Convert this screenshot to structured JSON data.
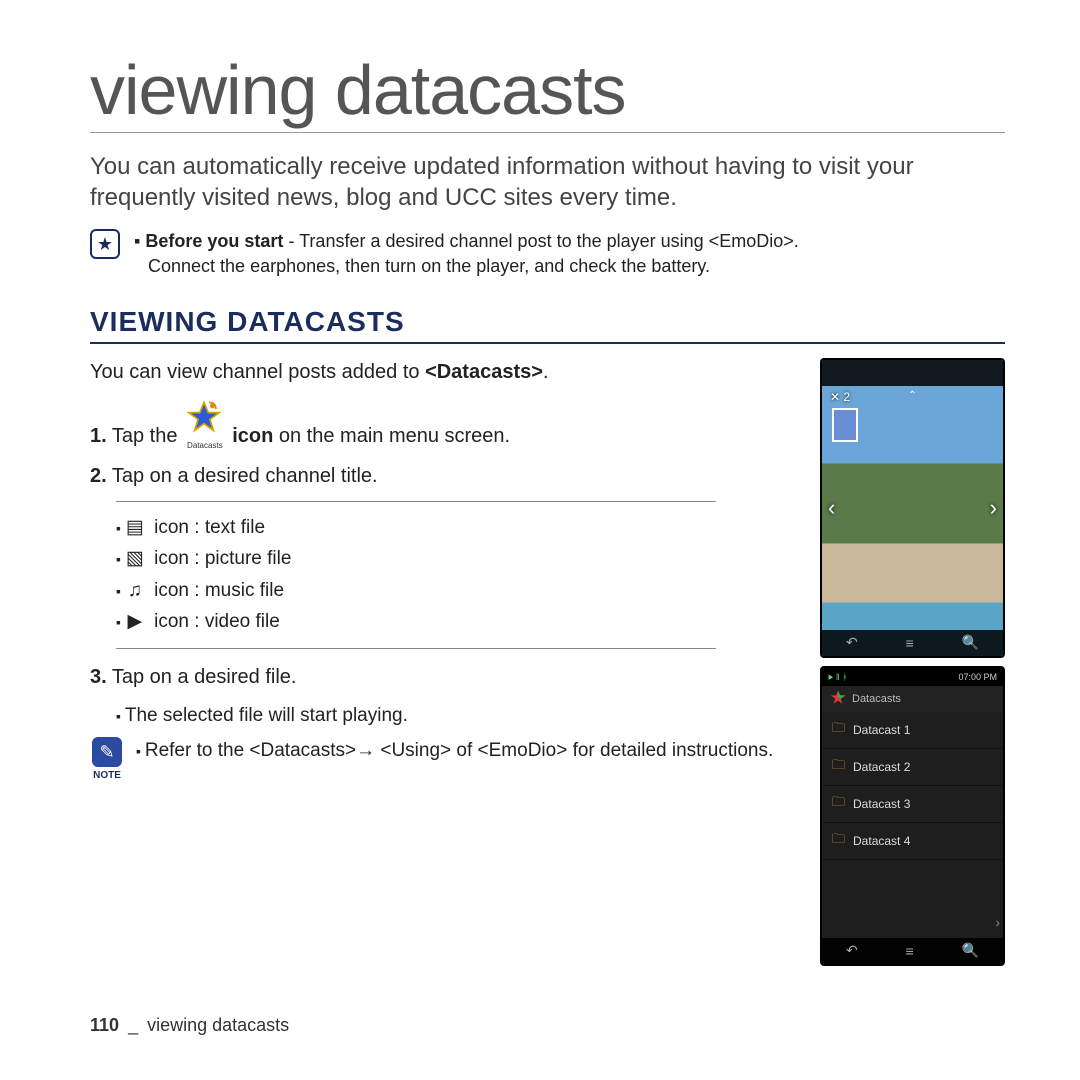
{
  "page": {
    "title": "viewing datacasts",
    "intro": "You can automatically receive updated information without having to visit your frequently visited news, blog and UCC sites every time.",
    "footer_page": "110",
    "footer_sep": "_",
    "footer_text": "viewing datacasts"
  },
  "before": {
    "lead": "Before you start",
    "text1": " - Transfer a desired channel post to the player using <EmoDio>.",
    "text2": "Connect the earphones, then turn on the player, and check the battery."
  },
  "section": {
    "heading": "VIEWING DATACASTS",
    "sub_intro_a": "You can view channel posts added to ",
    "sub_intro_b": "<Datacasts>",
    "sub_intro_c": ".",
    "icon_caption": "Datacasts",
    "step1_num": "1.",
    "step1_a": " Tap the ",
    "step1_b": "icon",
    "step1_c": " on the main menu screen.",
    "step2_num": "2.",
    "step2": " Tap on a desired channel title.",
    "icons": {
      "text": " icon : text file",
      "picture": " icon : picture file",
      "music": " icon : music file",
      "video": " icon : video file"
    },
    "step3_num": "3.",
    "step3": " Tap on a desired file.",
    "step3_sub": "The selected file will start playing.",
    "note_label": "NOTE",
    "note": "Refer to the <Datacasts>→ <Using> of <EmoDio> for detailed instructions."
  },
  "phone1": {
    "x": "✕ 2",
    "back": "↶",
    "menu": "≡",
    "search": "🔍"
  },
  "phone2": {
    "time": "07:00 PM",
    "header": "Datacasts",
    "items": [
      "Datacast 1",
      "Datacast 2",
      "Datacast 3",
      "Datacast 4"
    ],
    "back": "↶",
    "menu": "≡",
    "search": "🔍"
  }
}
